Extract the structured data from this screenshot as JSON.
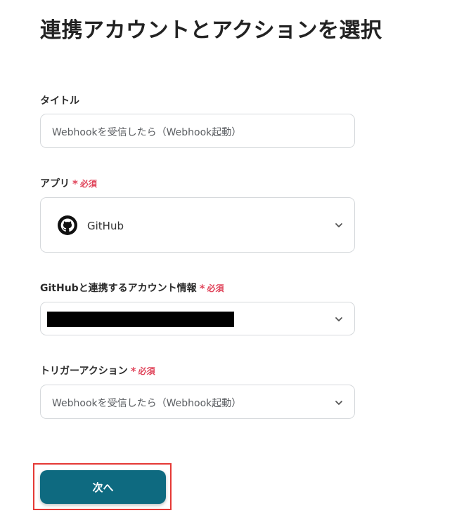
{
  "page_title": "連携アカウントとアクションを選択",
  "title_field": {
    "label": "タイトル",
    "value": "Webhookを受信したら（Webhook起動）"
  },
  "app_field": {
    "label": "アプリ",
    "required_label": "必須",
    "value": "GitHub",
    "icon": "github-icon"
  },
  "account_field": {
    "label": "GitHubと連携するアカウント情報",
    "required_label": "必須"
  },
  "trigger_field": {
    "label": "トリガーアクション",
    "required_label": "必須",
    "value": "Webhookを受信したら（Webhook起動）"
  },
  "next_button": {
    "label": "次へ"
  },
  "colors": {
    "accent": "#0e6a80",
    "required": "#e0455b",
    "highlight_outline": "#e53935"
  }
}
